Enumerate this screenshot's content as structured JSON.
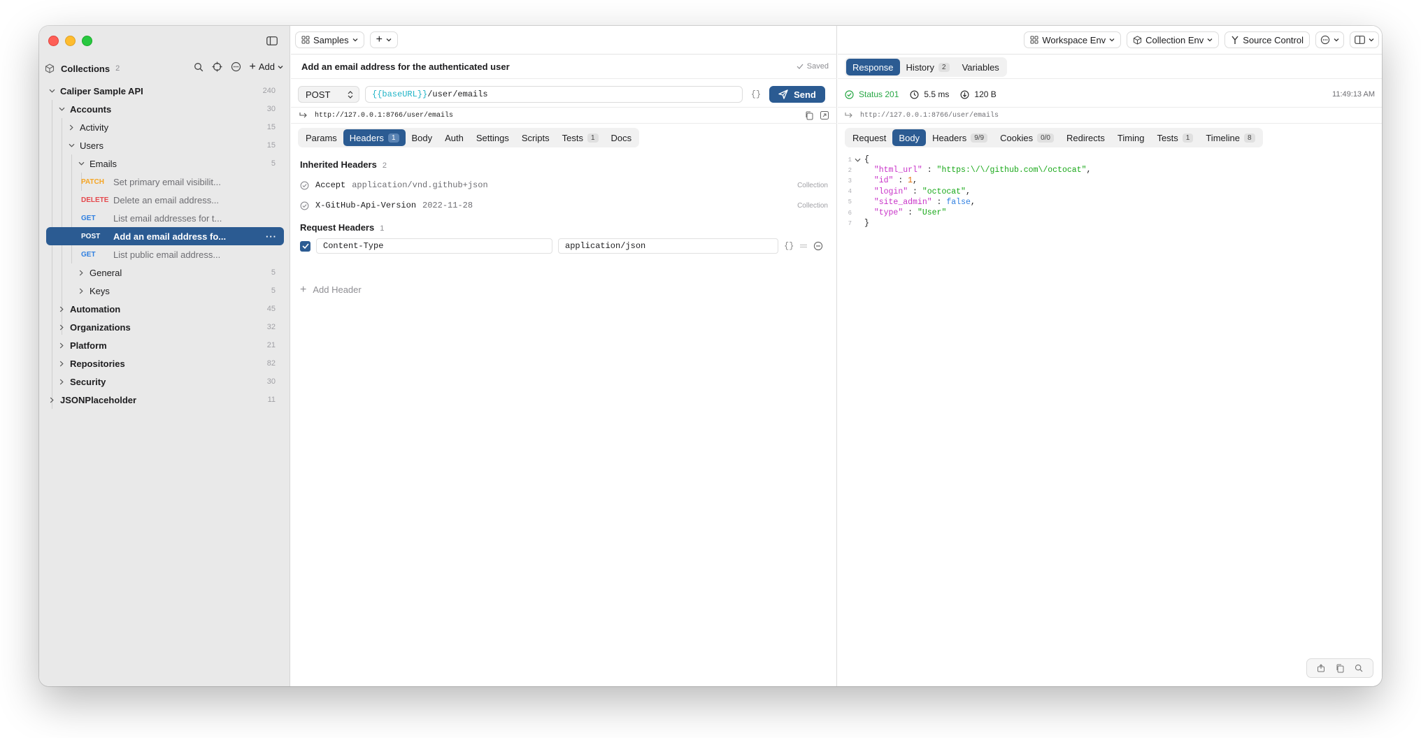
{
  "sidebar": {
    "title": "Collections",
    "count": "2",
    "add_label": "Add",
    "tree": [
      {
        "label": "Caliper Sample API",
        "count": "240",
        "level": 0,
        "expanded": true,
        "bold": true
      },
      {
        "label": "Accounts",
        "count": "30",
        "level": 1,
        "expanded": true,
        "bold": true
      },
      {
        "label": "Activity",
        "count": "15",
        "level": 2,
        "expanded": false
      },
      {
        "label": "Users",
        "count": "15",
        "level": 2,
        "expanded": true
      },
      {
        "label": "Emails",
        "count": "5",
        "level": 3,
        "expanded": true
      },
      {
        "method": "PATCH",
        "label": "Set primary email visibilit...",
        "level": 4
      },
      {
        "method": "DELETE",
        "label": "Delete an email address...",
        "level": 4
      },
      {
        "method": "GET",
        "label": "List email addresses for t...",
        "level": 4
      },
      {
        "method": "POST",
        "label": "Add an email address fo...",
        "level": 4,
        "selected": true
      },
      {
        "method": "GET",
        "label": "List public email address...",
        "level": 4
      },
      {
        "label": "General",
        "count": "5",
        "level": 3,
        "expanded": false
      },
      {
        "label": "Keys",
        "count": "5",
        "level": 3,
        "expanded": false
      },
      {
        "label": "Automation",
        "count": "45",
        "level": 1,
        "expanded": false,
        "bold": true
      },
      {
        "label": "Organizations",
        "count": "32",
        "level": 1,
        "expanded": false,
        "bold": true
      },
      {
        "label": "Platform",
        "count": "21",
        "level": 1,
        "expanded": false,
        "bold": true
      },
      {
        "label": "Repositories",
        "count": "82",
        "level": 1,
        "expanded": false,
        "bold": true
      },
      {
        "label": "Security",
        "count": "30",
        "level": 1,
        "expanded": false,
        "bold": true
      },
      {
        "label": "JSONPlaceholder",
        "count": "11",
        "level": 0,
        "expanded": false,
        "bold": true
      }
    ]
  },
  "toolbar": {
    "samples_label": "Samples",
    "new_tab_label": "+",
    "workspace_env": "Workspace Env",
    "collection_env": "Collection Env",
    "source_control": "Source Control"
  },
  "request": {
    "title": "Add an email address for the authenticated user",
    "saved_label": "Saved",
    "method": "POST",
    "url_var": "{{baseURL}}",
    "url_path": "/user/emails",
    "braces": "{}",
    "send_label": "Send",
    "resolved_url": "http://127.0.0.1:8766/user/emails",
    "tabs": [
      {
        "label": "Params"
      },
      {
        "label": "Headers",
        "badge": "1",
        "active": true
      },
      {
        "label": "Body"
      },
      {
        "label": "Auth"
      },
      {
        "label": "Settings"
      },
      {
        "label": "Scripts"
      },
      {
        "label": "Tests",
        "badge": "1"
      },
      {
        "label": "Docs"
      }
    ],
    "inherited_title": "Inherited Headers",
    "inherited_count": "2",
    "inherited": [
      {
        "key": "Accept",
        "value": "application/vnd.github+json",
        "source": "Collection"
      },
      {
        "key": "X-GitHub-Api-Version",
        "value": "2022-11-28",
        "source": "Collection"
      }
    ],
    "request_headers_title": "Request Headers",
    "request_headers_count": "1",
    "header_key": "Content-Type",
    "header_value": "application/json",
    "add_header_label": "Add Header"
  },
  "response": {
    "top_tabs": [
      {
        "label": "Response",
        "active": true
      },
      {
        "label": "History",
        "badge": "2"
      },
      {
        "label": "Variables"
      }
    ],
    "status": "Status 201",
    "duration": "5.5 ms",
    "size": "120 B",
    "time": "11:49:13 AM",
    "resolved_url": "http://127.0.0.1:8766/user/emails",
    "tabs": [
      {
        "label": "Request"
      },
      {
        "label": "Body",
        "active": true
      },
      {
        "label": "Headers",
        "badge": "9/9"
      },
      {
        "label": "Cookies",
        "badge": "0/0"
      },
      {
        "label": "Redirects"
      },
      {
        "label": "Timing"
      },
      {
        "label": "Tests",
        "badge": "1"
      },
      {
        "label": "Timeline",
        "badge": "8"
      }
    ],
    "body_lines": [
      "{",
      "  \"html_url\" : \"https:\\/\\/github.com\\/octocat\",",
      "  \"id\" : 1,",
      "  \"login\" : \"octocat\",",
      "  \"site_admin\" : false,",
      "  \"type\" : \"User\"",
      "}"
    ]
  },
  "colors": {
    "accent": "#2b5b92",
    "patch": "#f5a524",
    "delete": "#e5484d",
    "get": "#2f7fe0",
    "status_ok": "#28a745"
  }
}
